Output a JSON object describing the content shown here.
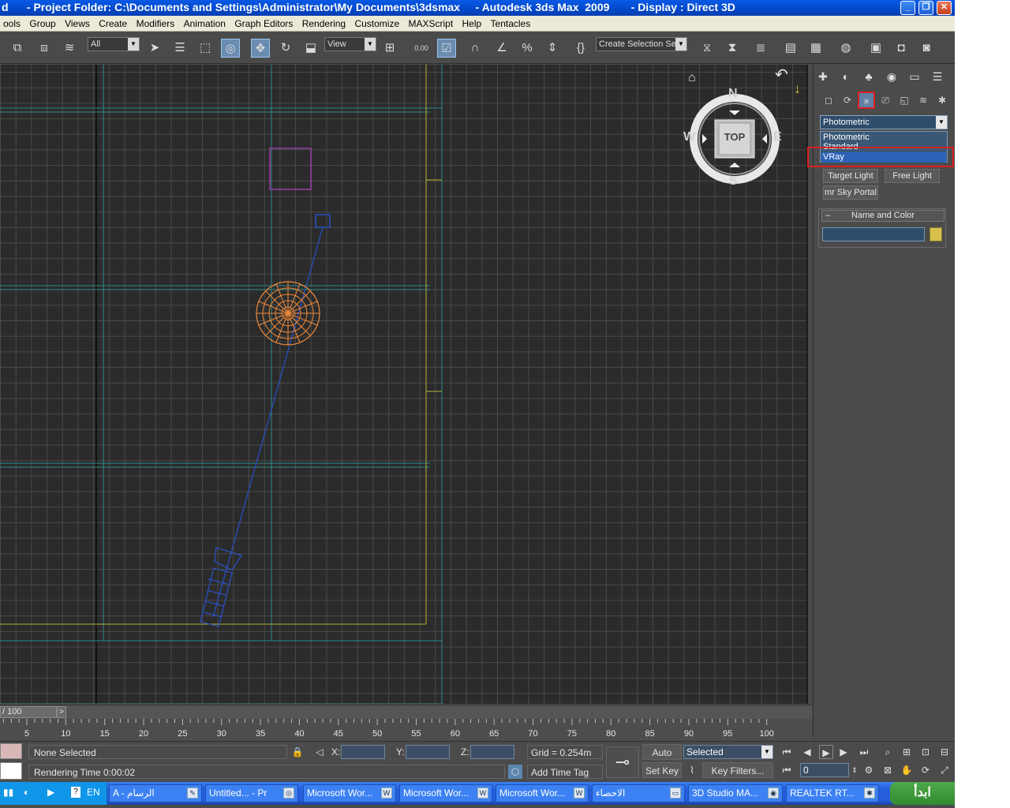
{
  "window": {
    "title": "d      - Project Folder: C:\\Documents and Settings\\Administrator\\My Documents\\3dsmax     - Autodesk 3ds Max  2009       - Display : Direct 3D",
    "minimize": "_",
    "maximize": "❐",
    "close": "✕"
  },
  "menu": [
    "ools",
    "Group",
    "Views",
    "Create",
    "Modifiers",
    "Animation",
    "Graph Editors",
    "Rendering",
    "Customize",
    "MAXScript",
    "Help",
    "Tentacles"
  ],
  "toolbar": {
    "filter_value": "All",
    "coord_value": "View",
    "selection_set_placeholder": "Create Selection Se",
    "angle_snap": "0.00"
  },
  "viewport": {
    "label": "TOP",
    "compass": {
      "n": "N",
      "s": "S",
      "e": "E",
      "w": "W"
    }
  },
  "command_panel": {
    "category_value": "Photometric",
    "category_options": [
      "Photometric",
      "Standard",
      "VRay"
    ],
    "selected_option": "VRay",
    "buttons": [
      "Target Light",
      "Free Light",
      "mr Sky Portal"
    ],
    "rollout_title": "Name and Color",
    "rollout_toggle": "–",
    "object_color": "#d8c04d"
  },
  "time_slider": {
    "frame": "/ 100",
    "next": ">"
  },
  "trackbar": {
    "ticks": [
      "5",
      "10",
      "15",
      "20",
      "25",
      "30",
      "35",
      "40",
      "45",
      "50",
      "55",
      "60",
      "65",
      "70",
      "75",
      "80",
      "85",
      "90",
      "95",
      "100"
    ]
  },
  "status": {
    "selection": "None Selected",
    "prompt": "Rendering Time  0:00:02",
    "x_label": "X:",
    "y_label": "Y:",
    "z_label": "Z:",
    "grid": "Grid = 0.254m",
    "add_time_tag": "Add Time Tag",
    "auto_key": "Auto Key",
    "set_key": "Set Key",
    "key_mode": "Selected",
    "key_filters": "Key Filters...",
    "current_frame": "0"
  },
  "taskbar": {
    "language": "EN",
    "tasks": [
      "A - الرسام",
      "Untitled... - Pr",
      "Microsoft Wor...",
      "Microsoft Wor...",
      "Microsoft Wor...",
      "الاحصاء",
      "3D Studio MA...",
      "REALTEK RT..."
    ],
    "start_label": "ابدأ"
  }
}
